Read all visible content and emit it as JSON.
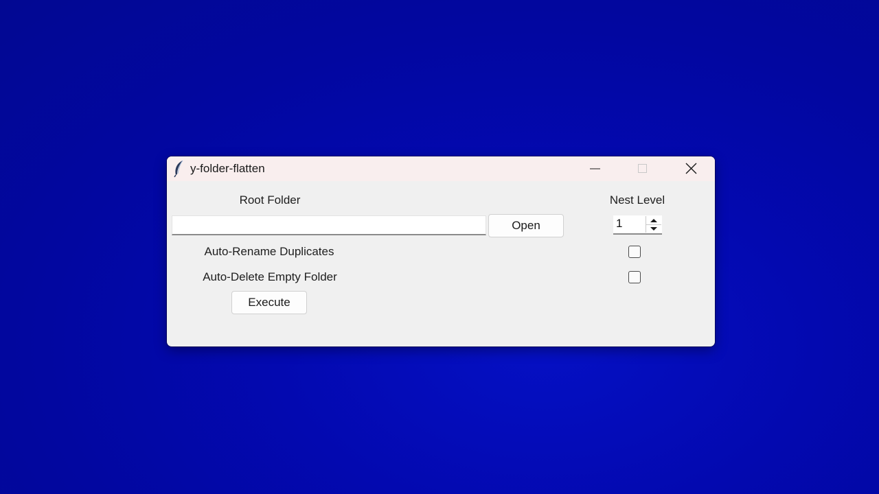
{
  "window": {
    "title": "y-folder-flatten"
  },
  "form": {
    "root_folder_label": "Root Folder",
    "root_folder_value": "",
    "open_button": "Open",
    "nest_level_label": "Nest Level",
    "nest_level_value": "1",
    "rename_label": "Auto-Rename Duplicates",
    "rename_checked": false,
    "delete_label": "Auto-Delete Empty Folder",
    "delete_checked": false,
    "execute_button": "Execute"
  },
  "icons": {
    "app": "feather-icon",
    "minimize": "minimize-icon",
    "maximize": "maximize-icon",
    "close": "close-icon",
    "spin_up": "arrow-up-icon",
    "spin_down": "arrow-down-icon"
  },
  "colors": {
    "desktop_background": "#0309b0",
    "window_background": "#f0f0f0",
    "titlebar_background": "#f9eeee"
  }
}
